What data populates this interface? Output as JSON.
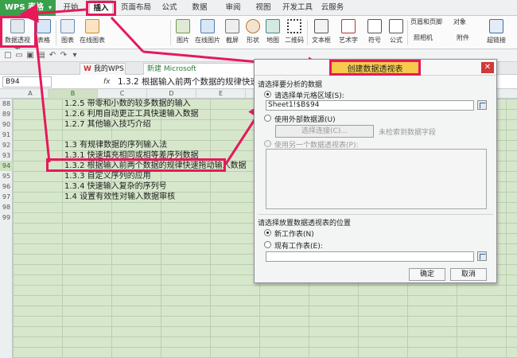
{
  "app": {
    "name": "WPS 表格"
  },
  "menu": {
    "items": [
      "开始",
      "插入",
      "页面布局",
      "公式",
      "数据",
      "审阅",
      "视图",
      "开发工具",
      "云服务"
    ],
    "active": "插入"
  },
  "ribbon": {
    "items": [
      "数据透视表",
      "表格",
      "图表",
      "在线图表",
      "图片",
      "在线图片",
      "截屏",
      "形状",
      "地图",
      "二维码",
      "文本框",
      "艺术字",
      "符号",
      "公式",
      "页眉和页脚",
      "对象",
      "照相机",
      "附件",
      "超链接"
    ]
  },
  "tabs": {
    "doc1": "我的WPS",
    "doc2": "新建 Microsoft"
  },
  "formula_bar": {
    "name_box": "B94",
    "fx": "fx",
    "content": "1.3.2 根据输入前两个数据的规律快速指"
  },
  "grid": {
    "columns": [
      "A",
      "B",
      "C",
      "D",
      "E"
    ],
    "rows": [
      "88",
      "89",
      "90",
      "91",
      "92",
      "93",
      "94",
      "95",
      "96",
      "97",
      "98",
      "99"
    ],
    "selected_row": "94",
    "cells": [
      "1.2.5 带零和小数的较多数据的输入",
      "1.2.6 利用自动更正工具快速输入数据",
      "1.2.7 其他输入技巧介绍",
      "",
      "1.3 有规律数据的序列输入法",
      "1.3.1 快速填充相同或相等差序列数据",
      "1.3.2 根据输入前两个数据的规律快速拖动输入数据",
      "1.3.3 自定义序列的应用",
      "1.3.4 快速输入复杂的序列号",
      "1.4 设置有效性对输入数据审核"
    ]
  },
  "dialog": {
    "title": "创建数据透视表",
    "section1": "请选择要分析的数据",
    "opt_range": "请选择单元格区域(S):",
    "range_value": "Sheet1!$B$94",
    "opt_external": "使用外部数据源(U)",
    "btn_select_conn": "选择连接(C)...",
    "no_fields": "未检索到数据字段",
    "opt_other_pivot": "使用另一个数据透视表(P):",
    "section2": "请选择放置数据透视表的位置",
    "opt_new_sheet": "新工作表(N)",
    "opt_existing": "现有工作表(E):",
    "ok": "确定",
    "cancel": "取消"
  }
}
